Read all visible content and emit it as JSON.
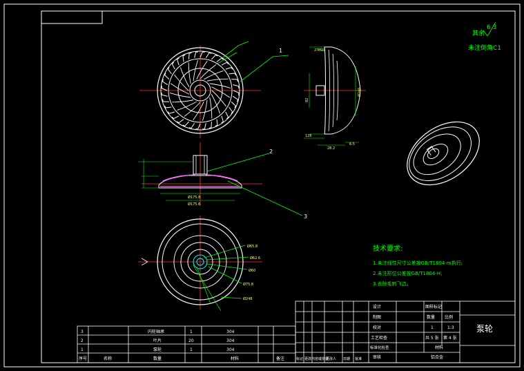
{
  "drawing": {
    "title": "泵轮",
    "roughness": {
      "value": "6.3",
      "note_prefix": "其余",
      "note_chamfer": "未注倒角C1"
    },
    "tech_requirements": {
      "heading": "技术要求:",
      "items": [
        "1.未注线性尺寸公差按GB/T1804-m执行;",
        "2.未注形位公差按GB/T1804-H;",
        "3.去除毛刺飞边。"
      ]
    },
    "callouts": [
      "1",
      "2",
      "3"
    ],
    "side_view_dims": [
      "2-R50",
      "Ø246",
      "82",
      "126",
      "28.2",
      "6.5"
    ],
    "section_dims": [
      "Ø175.8",
      "Ø175.6"
    ],
    "bottom_dims": [
      "Ø65.8",
      "Ø62.6",
      "Ø60",
      "Ø75.8",
      "Ø248"
    ],
    "title_block": {
      "rows": [
        {
          "label": "设计",
          "value": "",
          "col2": "图样标记",
          "col3": ""
        },
        {
          "label": "制图",
          "value": "",
          "col2": "数量",
          "col3": "比例"
        },
        {
          "label": "校对",
          "value": "",
          "col2": "1",
          "col3": "1:3"
        },
        {
          "label": "工艺检查",
          "value": "",
          "col2": "共 5 张",
          "col3": "第 4 张"
        },
        {
          "label": "标准化检查",
          "value": "",
          "col2": "材料",
          "col3": ""
        },
        {
          "label": "审核",
          "value": "",
          "col2": "铝合金",
          "col3": ""
        }
      ],
      "bottom_labels": [
        "标记",
        "更改内容或依据",
        "更改人",
        "日期",
        "批准"
      ]
    },
    "parts_list": {
      "rows": [
        {
          "no": "3",
          "name": "内轮轴承",
          "qty": "1",
          "material": "304"
        },
        {
          "no": "2",
          "name": "叶片",
          "qty": "20",
          "material": "304"
        },
        {
          "no": "1",
          "name": "泵轮",
          "qty": "1",
          "material": "304"
        }
      ],
      "header": {
        "no": "序号",
        "name": "名称",
        "qty": "数量",
        "material": "材料",
        "note": "备注"
      }
    }
  }
}
